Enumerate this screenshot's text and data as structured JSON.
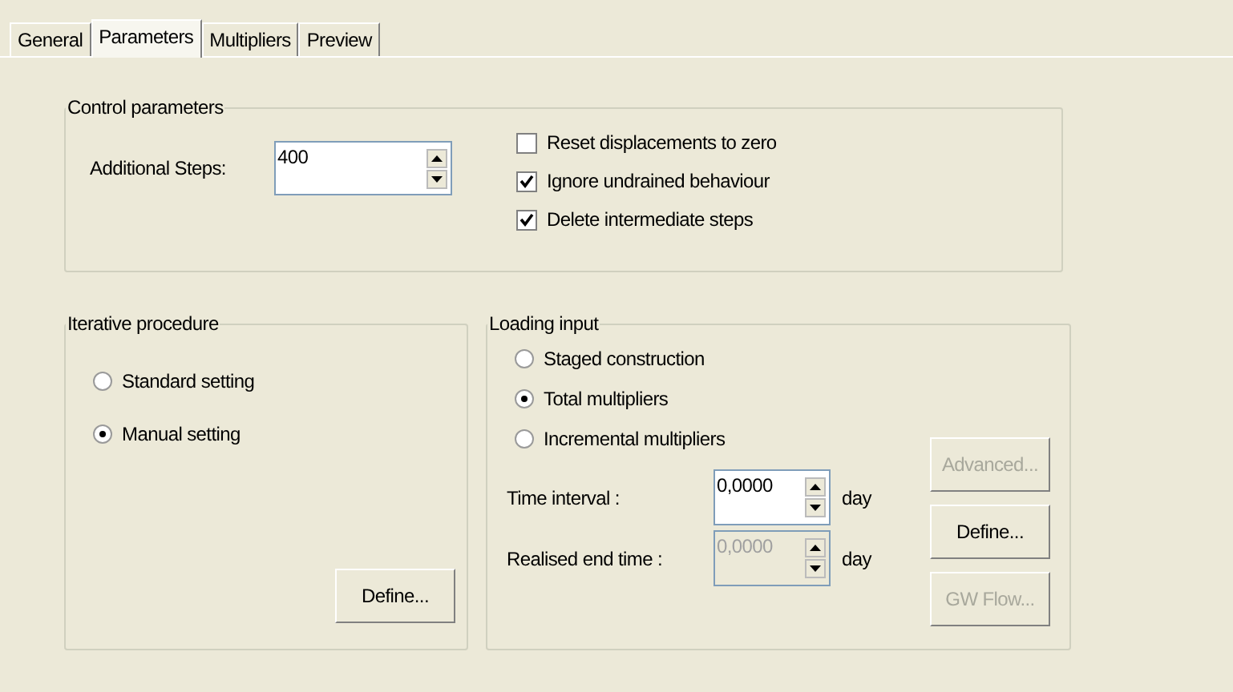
{
  "tabs": [
    {
      "label": "General",
      "selected": false
    },
    {
      "label": "Parameters",
      "selected": true
    },
    {
      "label": "Multipliers",
      "selected": false
    },
    {
      "label": "Preview",
      "selected": false
    }
  ],
  "control_parameters": {
    "title": "Control parameters",
    "additional_steps": {
      "label": "Additional Steps:",
      "value": "400"
    },
    "options": [
      {
        "label": "Reset displacements to zero",
        "checked": false
      },
      {
        "label": "Ignore undrained behaviour",
        "checked": true
      },
      {
        "label": "Delete intermediate steps",
        "checked": true
      }
    ]
  },
  "iterative_procedure": {
    "title": "Iterative procedure",
    "options": [
      {
        "label": "Standard setting",
        "selected": false
      },
      {
        "label": "Manual setting",
        "selected": true
      }
    ],
    "button": {
      "label": "Define...",
      "disabled": false
    }
  },
  "loading_input": {
    "title": "Loading input",
    "options": [
      {
        "label": "Staged construction",
        "selected": false
      },
      {
        "label": "Total multipliers",
        "selected": true
      },
      {
        "label": "Incremental multipliers",
        "selected": false
      }
    ],
    "fields": [
      {
        "label": "Time interval :",
        "value": "0,0000",
        "unit": "day",
        "disabled": false
      },
      {
        "label": "Realised end time :",
        "value": "0,0000",
        "unit": "day",
        "disabled": true
      }
    ],
    "buttons": [
      {
        "label": "Advanced...",
        "disabled": true
      },
      {
        "label": "Define...",
        "disabled": false
      },
      {
        "label": "GW Flow...",
        "disabled": true
      }
    ]
  }
}
